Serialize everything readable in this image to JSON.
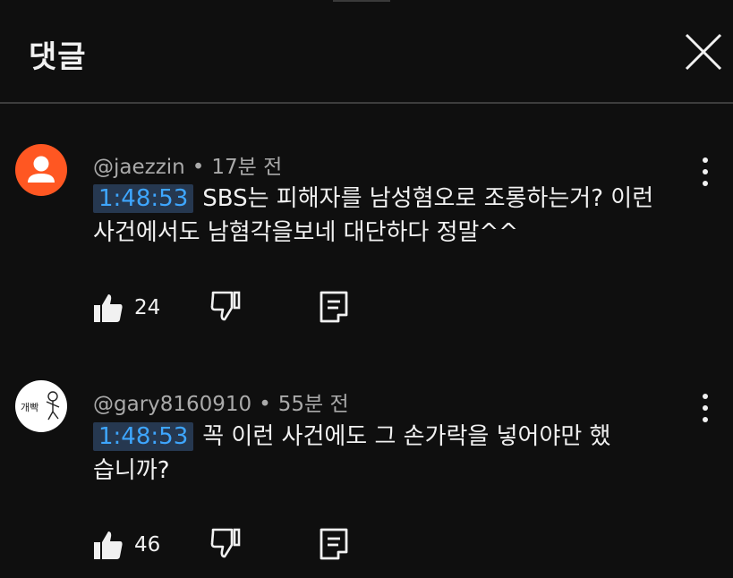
{
  "header": {
    "title": "댓글",
    "close_icon": "close-icon"
  },
  "colors": {
    "background": "#0f0f0f",
    "timestamp_bg": "#263850",
    "timestamp_text": "#3ea6ff",
    "avatar_orange": "#ff5722",
    "meta_text": "#aaaaaa"
  },
  "comments": [
    {
      "author": "@jaezzin",
      "separator": "•",
      "time_ago": "17분 전",
      "timestamp": "1:48:53",
      "text": "SBS는 피해자를 남성혐오로 조롱하는거? 이런사건에서도 남혐각을보네 대단하다 정말^^",
      "like_count": "24",
      "avatar_icon": "default-person-icon"
    },
    {
      "author": "@gary8160910",
      "separator": "•",
      "time_ago": "55분 전",
      "timestamp": "1:48:53",
      "text": "꼭 이런 사건에도 그 손가락을 넣어야만 했습니까?",
      "like_count": "46",
      "avatar_icon": "doodle-avatar-icon"
    }
  ]
}
